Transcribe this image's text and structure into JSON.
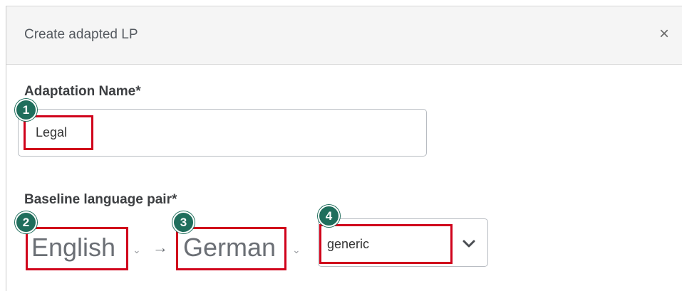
{
  "dialog": {
    "title": "Create adapted LP",
    "close_glyph": "×"
  },
  "form": {
    "adaptation_name": {
      "label": "Adaptation Name*",
      "value": "Legal"
    },
    "baseline": {
      "label": "Baseline language pair*",
      "source_language": "English",
      "target_language": "German",
      "arrow": "→",
      "variant": "generic"
    }
  },
  "markers": [
    "1",
    "2",
    "3",
    "4"
  ],
  "colors": {
    "highlight": "#d0021b",
    "marker": "#1f6e5c"
  }
}
